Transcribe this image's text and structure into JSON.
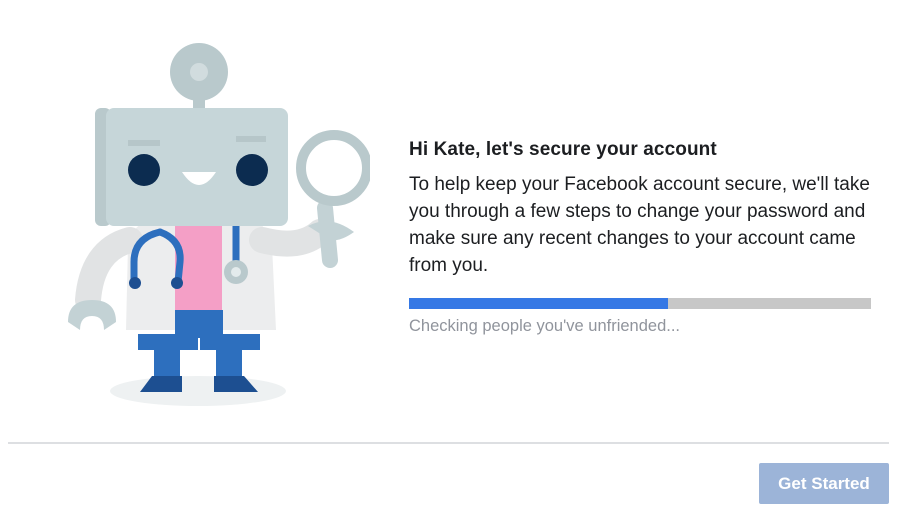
{
  "illustration": {
    "name": "robot-doctor-illustration"
  },
  "header": {
    "title": "Hi Kate, let's secure your account"
  },
  "body": {
    "description": "To help keep your Facebook account secure, we'll take you through a few steps to change your password and make sure any recent changes to your account came from you."
  },
  "progress": {
    "value_percent": 56,
    "status_text": "Checking people you've unfriended..."
  },
  "footer": {
    "button_label": "Get Started"
  },
  "colors": {
    "progress_fill": "#3578e5",
    "progress_track": "#c7c7c7",
    "button_disabled": "#9cb4d8",
    "status_text": "#90949c"
  }
}
